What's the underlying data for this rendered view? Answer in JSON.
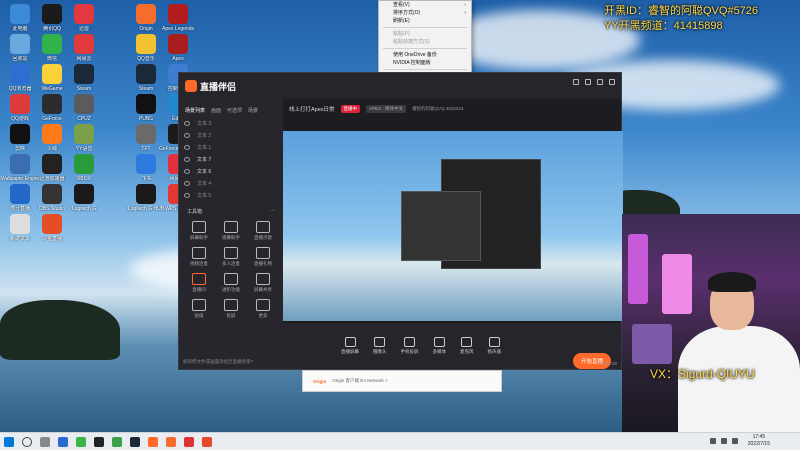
{
  "overlay": {
    "channel_id_label": "开黑ID：睿智的阿聪QVQ#5726",
    "yy_channel_label": "YY开黑频道：41415898",
    "wechat_label": "VX：Sigurd-QIUYU",
    "cam_tag": "VX：Sigurd-QIUYU"
  },
  "desktop_icons": [
    {
      "label": "此电脑",
      "color": "#3b8ad9"
    },
    {
      "label": "腾讯QQ",
      "color": "#1b1b1b"
    },
    {
      "label": "迅雷",
      "color": "#e2383f"
    },
    {
      "label": "Origin",
      "color": "#f56c2d"
    },
    {
      "label": "Apex Legends",
      "color": "#b31c1c"
    },
    {
      "label": "回收站",
      "color": "#6aa8e0"
    },
    {
      "label": "微信",
      "color": "#2fb34a"
    },
    {
      "label": "网易云",
      "color": "#e23a3a"
    },
    {
      "label": "QQ音乐",
      "color": "#f3c230"
    },
    {
      "label": "Apex",
      "color": "#a81d1d"
    },
    {
      "label": "QQ浏览器",
      "color": "#2c6ed1"
    },
    {
      "label": "WeGame",
      "color": "#fdd13a"
    },
    {
      "label": "Steam",
      "color": "#1b2838"
    },
    {
      "label": "Steam",
      "color": "#1b2838"
    },
    {
      "label": "控制面板",
      "color": "#3e7dd2"
    },
    {
      "label": "QQ游戏",
      "color": "#dd3b3b"
    },
    {
      "label": "GeForce",
      "color": "#2c2c2c"
    },
    {
      "label": "CPUZ",
      "color": "#5b5b5b"
    },
    {
      "label": "PUBG",
      "color": "#111111"
    },
    {
      "label": "Edge",
      "color": "#1f8ad0"
    },
    {
      "label": "剪映",
      "color": "#111111"
    },
    {
      "label": "火绒",
      "color": "#ff7a1a"
    },
    {
      "label": "YY语音",
      "color": "#7aa04a"
    },
    {
      "label": "TFT",
      "color": "#6a6a6a"
    },
    {
      "label": "GeForce Experience",
      "color": "#1a1a1a"
    },
    {
      "label": "Wallpaper Engine",
      "color": "#3b6db0"
    },
    {
      "label": "迅游加速器",
      "color": "#222222"
    },
    {
      "label": "XBOX",
      "color": "#2a9b3a"
    },
    {
      "label": "飞书",
      "color": "#2d7be0"
    },
    {
      "label": "网易UU",
      "color": "#e3303a"
    },
    {
      "label": "虎牙直播",
      "color": "#2367c9"
    },
    {
      "label": "OBS Studio",
      "color": "#333333"
    },
    {
      "label": "Logitech G",
      "color": "#1a1a1a"
    },
    {
      "label": "Logitech G HUB",
      "color": "#1a1a1a"
    },
    {
      "label": "WPS Office",
      "color": "#e5372f"
    },
    {
      "label": "新建文本",
      "color": "#dddddd"
    },
    {
      "label": "斗鱼直播",
      "color": "#e44d26"
    }
  ],
  "context_menu": {
    "items": [
      {
        "label": "查看(V)",
        "disabled": false,
        "arrow": true
      },
      {
        "label": "排序方式(O)",
        "disabled": false,
        "arrow": true
      },
      {
        "label": "刷新(E)",
        "disabled": false,
        "arrow": false
      },
      {
        "label": "粘贴(P)",
        "disabled": true,
        "arrow": false
      },
      {
        "label": "粘贴快捷方式(S)",
        "disabled": true,
        "arrow": false
      },
      {
        "label": "使用 OneDrive 备份",
        "disabled": false,
        "arrow": false
      },
      {
        "label": "NVIDIA 控制面板",
        "disabled": false,
        "arrow": false
      },
      {
        "label": "新建(W)",
        "disabled": false,
        "arrow": true
      },
      {
        "label": "显示设置(D)",
        "disabled": false,
        "arrow": false
      },
      {
        "label": "个性化(R)",
        "disabled": false,
        "arrow": false
      }
    ]
  },
  "app": {
    "title": "直播伴侣",
    "scene_tabs": [
      "场景列表",
      "画面",
      "可选项",
      "场景"
    ],
    "scenes": [
      "文本 3",
      "文本 2",
      "文本 1",
      "文本 7",
      "文本 6",
      "文本 4",
      "文本 5"
    ],
    "toolbox_title": "工具箱",
    "tools": [
      "屏幕助手",
      "观赛助手",
      "直播点歌",
      "视频连麦",
      "多人连麦",
      "直播礼物",
      "直播间",
      "进阶功能",
      "屏幕共享",
      "贴纸",
      "投屏",
      "更多"
    ],
    "side_hint": "如何把文件或画面添加至直播场景?",
    "room_title": "线上打打Apex日常",
    "live_badge": "直播中",
    "room_tags": [
      "APEX · 简体中文"
    ],
    "room_id_label": "睿智的阿聪QVQ  4632223",
    "bottom_buttons": [
      "直播屏幕",
      "摄像头",
      "手机投屏",
      "多媒体",
      "麦克风",
      "扬声器"
    ],
    "start_live": "开始直播",
    "live_time": "00:00:00"
  },
  "origin_window": {
    "logo": "Origin",
    "text": "Origin 客户端  EA Network >"
  },
  "taskbar": {
    "clock_time": "17:45",
    "clock_date": "2022/7/15"
  }
}
